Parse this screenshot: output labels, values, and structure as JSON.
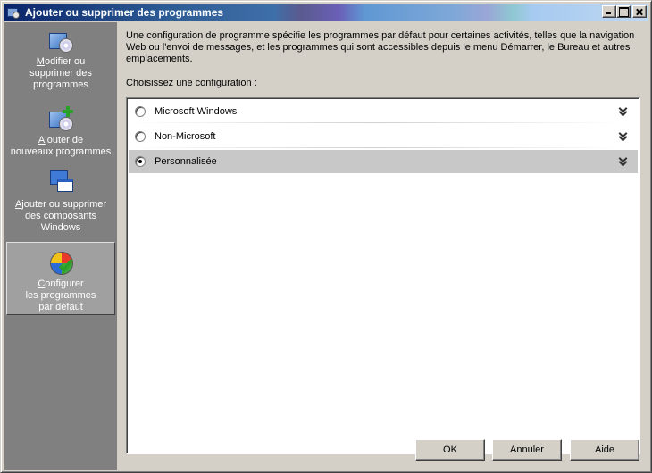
{
  "window": {
    "title": "Ajouter ou supprimer des programmes"
  },
  "sidebar": {
    "items": [
      {
        "label": "Modifier ou\nsupprimer des\nprogrammes",
        "icon": "program-cd-icon"
      },
      {
        "label": "Ajouter de\nnouveaux programmes",
        "icon": "add-program-icon"
      },
      {
        "label": "Ajouter ou supprimer\ndes composants\nWindows",
        "icon": "windows-components-icon"
      },
      {
        "label": "Configurer\nles programmes\npar défaut",
        "icon": "default-programs-icon",
        "active": true
      }
    ]
  },
  "main": {
    "description": "Une configuration de programme spécifie les programmes par défaut pour certaines activités, telles que la navigation Web ou l'envoi de messages, et les programmes qui sont accessibles depuis le menu Démarrer, le Bureau et autres emplacements.",
    "prompt": "Choisissez une configuration :",
    "options": [
      {
        "label": "Microsoft Windows",
        "selected": false
      },
      {
        "label": "Non-Microsoft",
        "selected": false
      },
      {
        "label": "Personnalisée",
        "selected": true
      }
    ]
  },
  "buttons": {
    "ok": "OK",
    "cancel": "Annuler",
    "help": "Aide"
  }
}
